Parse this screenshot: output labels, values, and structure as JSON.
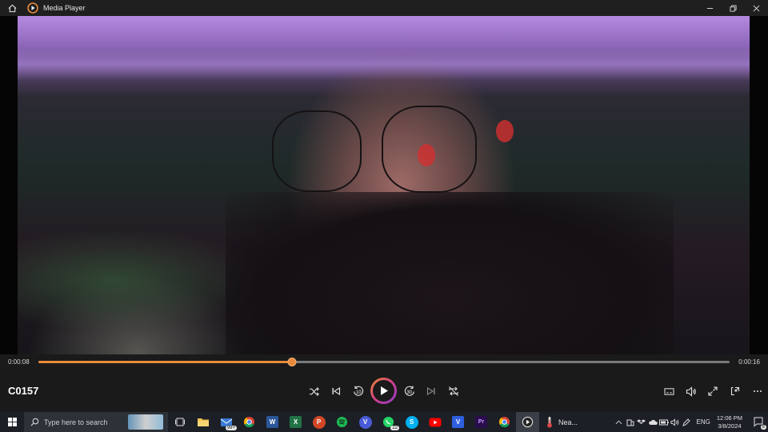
{
  "window": {
    "title": "Media Player"
  },
  "player": {
    "current_time": "0:00:08",
    "total_time": "0:00:16",
    "progress": 0.367,
    "media_title": "C0157",
    "accent_color": "#e88a3a",
    "buttons": [
      "shuffle",
      "previous",
      "rewind-10",
      "play",
      "forward-30",
      "next",
      "repeat-off",
      "captions",
      "volume",
      "full-screen",
      "mini-player",
      "more"
    ],
    "rewind_label": "10",
    "forward_label": "30"
  },
  "taskbar": {
    "search_placeholder": "Type here to search",
    "apps": [
      {
        "name": "task-view",
        "badge": ""
      },
      {
        "name": "file-explorer",
        "badge": ""
      },
      {
        "name": "mail",
        "badge": "99+"
      },
      {
        "name": "chrome",
        "badge": ""
      },
      {
        "name": "word",
        "badge": ""
      },
      {
        "name": "excel",
        "badge": ""
      },
      {
        "name": "powerpoint",
        "badge": ""
      },
      {
        "name": "spotify",
        "badge": ""
      },
      {
        "name": "vpn",
        "badge": ""
      },
      {
        "name": "whatsapp",
        "badge": "22"
      },
      {
        "name": "skype",
        "badge": ""
      },
      {
        "name": "youtube",
        "badge": ""
      },
      {
        "name": "vscode-like",
        "badge": ""
      },
      {
        "name": "premiere-pro",
        "badge": ""
      },
      {
        "name": "chrome-2",
        "badge": ""
      },
      {
        "name": "media-player",
        "badge": ""
      }
    ],
    "word_letter": "W",
    "excel_letter": "X",
    "ppt_letter": "P",
    "vpn_letter": "V",
    "skype_letter": "S",
    "v2_letter": "V",
    "premiere_letter": "Pr",
    "weather_text": "Nea...",
    "language": "ENG",
    "time": "12:06 PM",
    "date": "3/8/2024",
    "notification_count": "8"
  }
}
